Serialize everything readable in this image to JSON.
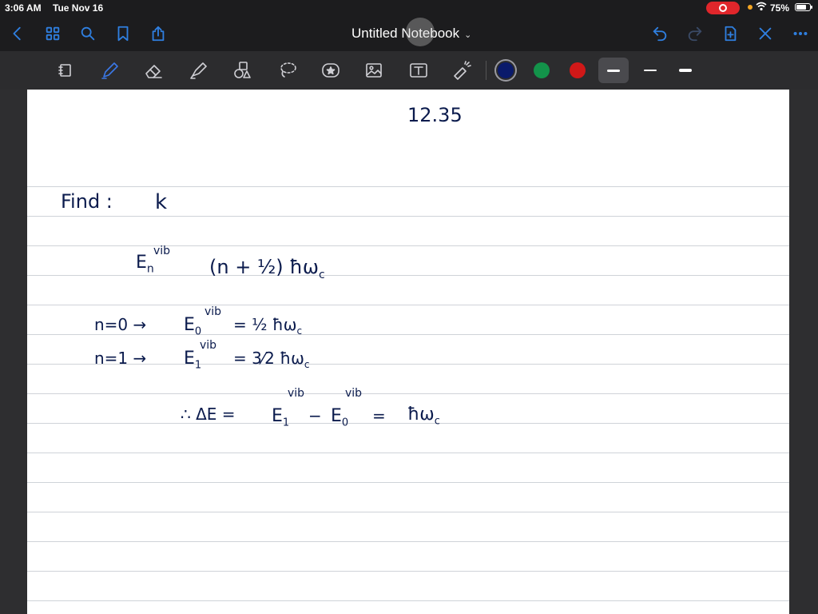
{
  "status": {
    "time": "3:06 AM",
    "date": "Tue Nov 16",
    "battery_pct": "75%",
    "battery_level": 0.75
  },
  "nav": {
    "title": "Untitled Notebook",
    "icons": [
      "back-icon",
      "grid-icon",
      "search-icon",
      "bookmark-icon",
      "share-icon",
      "undo-icon",
      "redo-icon",
      "add-page-icon",
      "close-icon",
      "more-icon"
    ]
  },
  "toolbar": {
    "tools": [
      "lasso-select-icon",
      "pen-icon",
      "eraser-icon",
      "highlighter-icon",
      "shapes-icon",
      "lasso-icon",
      "sticker-icon",
      "image-icon",
      "text-icon",
      "laser-pointer-icon"
    ],
    "colors": [
      "#0a1a6b",
      "#13934a",
      "#d01818"
    ],
    "selected_color": "#0a1a6b",
    "thickness_levels": 3,
    "selected_thickness": 1
  },
  "note": {
    "problem_number": "12.35",
    "find_label": "Find :",
    "find_value": "k",
    "eq1_lhs": "E",
    "eq1_sub": "n",
    "eq1_sup": "vib",
    "eq1_rhs": "(n + ½) ħω",
    "eq1_rhs_sub": "c",
    "eq2_cond": "n=0 →",
    "eq2_lhs": "E",
    "eq2_sub": "0",
    "eq2_sup": "vib",
    "eq2_rhs": "= ½ ħω",
    "eq2_rhs_sub": "c",
    "eq3_cond": "n=1 →",
    "eq3_lhs": "E",
    "eq3_sub": "1",
    "eq3_sup": "vib",
    "eq3_rhs": "= 3⁄2 ħω",
    "eq3_rhs_sub": "c",
    "eq4_prefix": "∴ ΔE =",
    "eq4_t1": "E",
    "eq4_t1_sub": "1",
    "eq4_t1_sup": "vib",
    "eq4_minus": "−",
    "eq4_t2": "E",
    "eq4_t2_sub": "0",
    "eq4_t2_sup": "vib",
    "eq4_eq": "=",
    "eq4_rhs": "ħω",
    "eq4_rhs_sub": "c"
  }
}
